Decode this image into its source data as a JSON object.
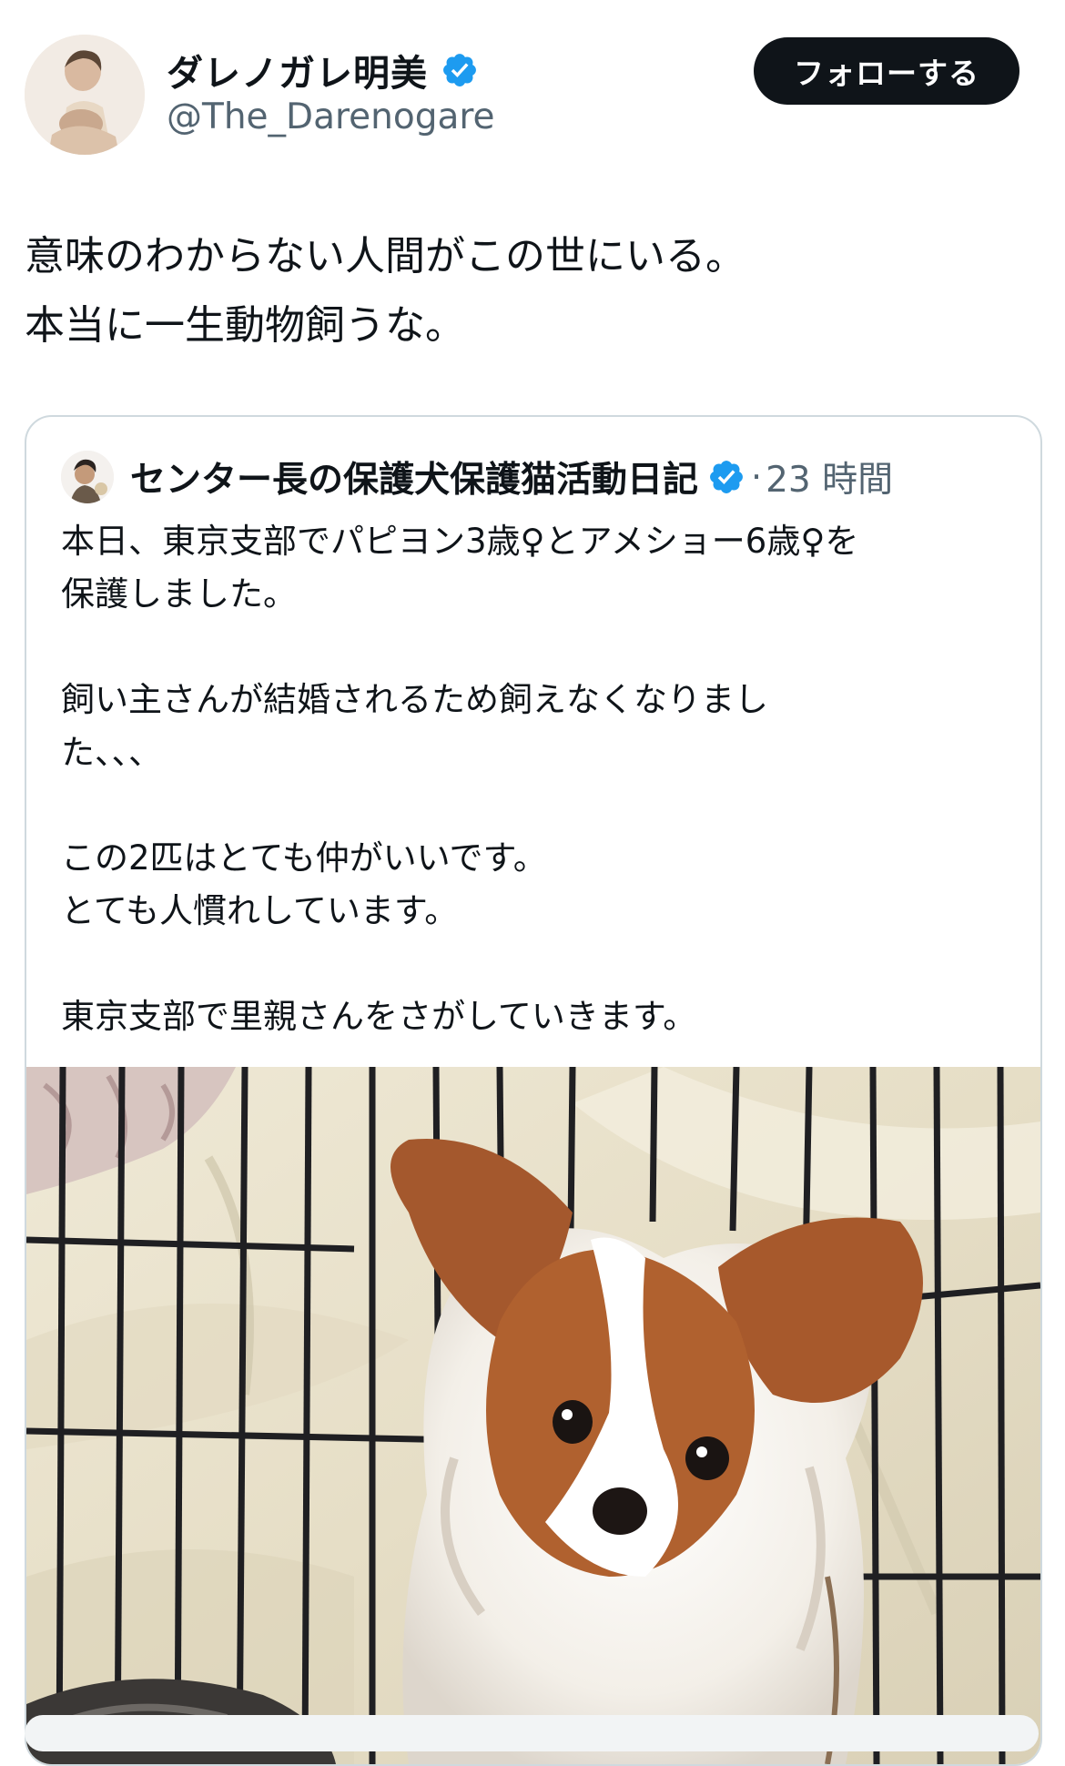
{
  "author": {
    "display_name": "ダレノガレ明美",
    "handle": "@The_Darenogare",
    "verified_icon": "verified-badge-icon",
    "follow_label": "フォローする"
  },
  "tweet": {
    "lines": [
      "意味のわからない人間がこの世にいる。",
      "本当に一生動物飼うな。"
    ]
  },
  "quoted_tweet": {
    "author_name": "センター長の保護犬保護猫活動日記",
    "separator": "·",
    "time": "23 時間",
    "text": {
      "l1": "本日、東京支部でパピヨン3歳♀とアメショー6歳♀を",
      "l2": "保護しました。",
      "l3": "飼い主さんが結婚されるため飼えなくなりまし",
      "l4": "た、、、",
      "l5": "この2匹はとても仲がいいです。",
      "l6": "とても人慣れしています。",
      "l7": "東京支部で里親さんをさがしていきます。"
    },
    "image_subject": "papillon-dog-in-cage-photo"
  },
  "colors": {
    "text_primary": "#0f1419",
    "text_secondary": "#536471",
    "verified_blue": "#1d9bf0",
    "border": "#cfd9de",
    "button_bg": "#0f1419"
  }
}
